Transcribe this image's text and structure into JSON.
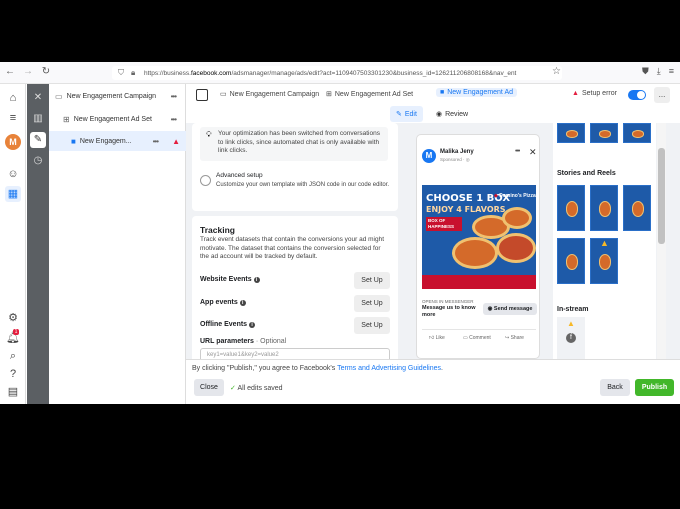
{
  "browser": {
    "url_prefix": "https://business.",
    "url_domain": "facebook.com",
    "url_rest": "/adsmanager/manage/ads/edit?act=1109407503301230&business_id=126211206808168&nav_ent"
  },
  "rail": {
    "avatar_letter": "M",
    "notification_count": "1"
  },
  "tree": {
    "campaign": "New Engagement Campaign",
    "adset": "New Engagement Ad Set",
    "ad": "New Engagem..."
  },
  "topbar": {
    "crumb_campaign": "New Engagement Campaign",
    "crumb_adset": "New Engagement Ad Set",
    "crumb_ad": "New Engagement Ad",
    "setup_error": "Setup error",
    "more": "..."
  },
  "tabs": {
    "edit": "Edit",
    "review": "Review"
  },
  "setup_card": {
    "optimization_note": "Your optimization has been switched from conversations to link clicks, since automated chat is only available with link clicks.",
    "advanced_title": "Advanced setup",
    "advanced_desc": "Customize your own template with JSON code in our code editor."
  },
  "tracking": {
    "title": "Tracking",
    "desc": "Track event datasets that contain the conversions your ad might motivate. The dataset that contains the conversion selected for the ad account will be tracked by default.",
    "rows": [
      {
        "label": "Website Events",
        "button": "Set Up"
      },
      {
        "label": "App events",
        "button": "Set Up"
      },
      {
        "label": "Offline Events",
        "button": "Set Up"
      }
    ],
    "url_params_label": "URL parameters",
    "url_params_optional": "· Optional",
    "url_params_placeholder": "key1=value1&key2=value2"
  },
  "preview": {
    "page_name": "Malika Jeny",
    "sponsored": "Sponsored · ",
    "page_initial": "M",
    "ad_line1": "CHOOSE 1 BOX",
    "ad_line2": "ENJOY 4 FLAVORS",
    "ad_badge": "BOX OF HAPPINESS",
    "brand": "Domino's Pizza",
    "opens_in": "OPENS IN MESSENGER",
    "message_text": "Message us to know more",
    "send_button": "Send message",
    "like": "Like",
    "comment": "Comment",
    "share": "Share"
  },
  "thumbnails": {
    "stories_label": "Stories and Reels",
    "instream_label": "In-stream"
  },
  "footer": {
    "disclaimer_prefix": "By clicking \"Publish,\" you agree to Facebook's ",
    "disclaimer_link": "Terms and Advertising Guidelines",
    "disclaimer_suffix": ".",
    "close": "Close",
    "saved": "All edits saved",
    "back": "Back",
    "publish": "Publish"
  },
  "colors": {
    "accent": "#1877f2",
    "publish": "#42b72a",
    "error": "#e41e3f",
    "dark_strip": "#5b5f63"
  }
}
